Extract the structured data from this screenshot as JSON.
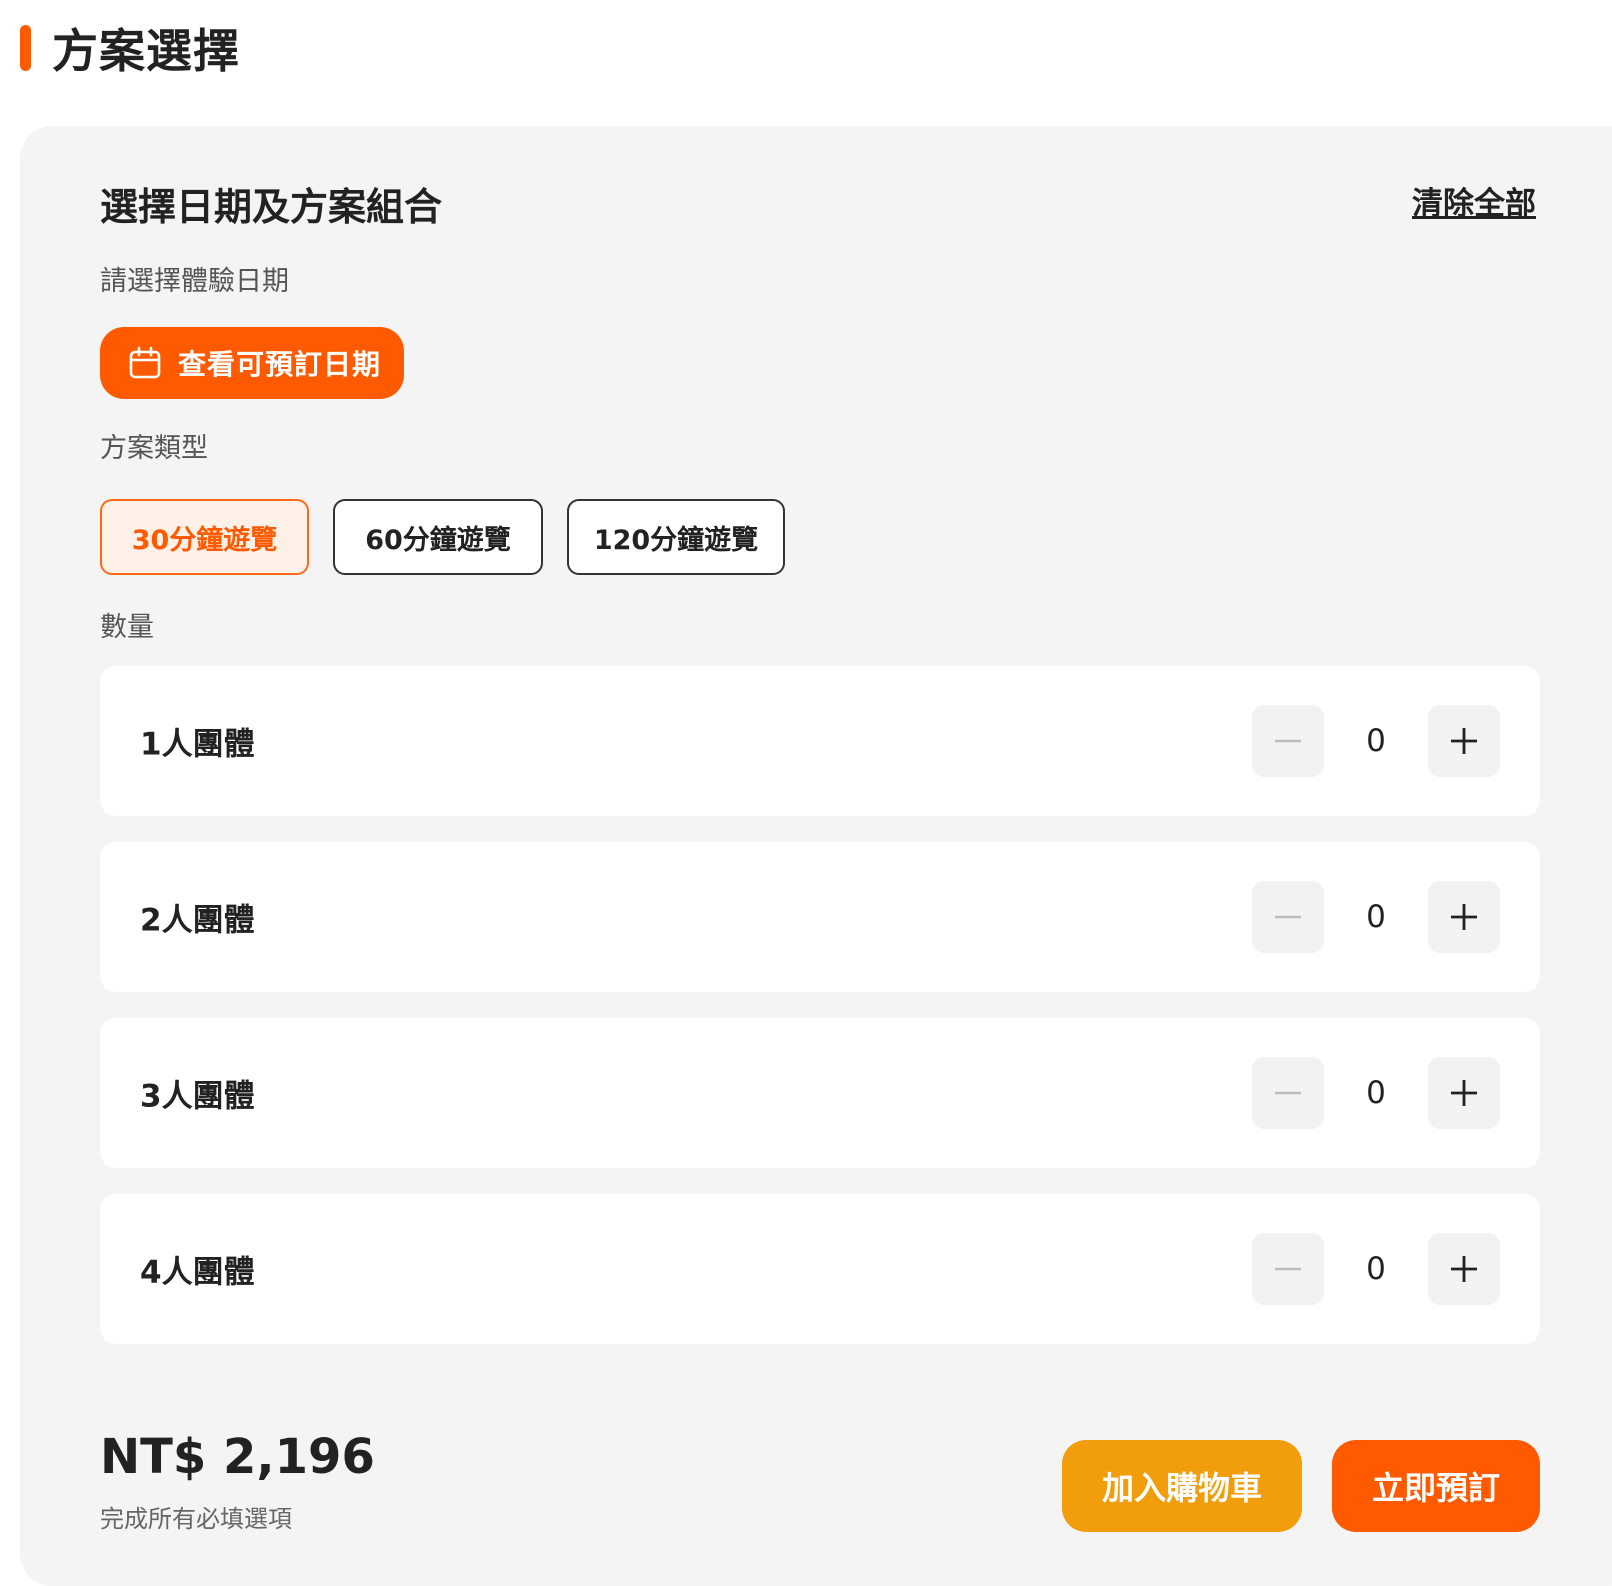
{
  "section": {
    "title": "方案選擇"
  },
  "panel": {
    "title": "選擇日期及方案組合",
    "clear_all": "清除全部"
  },
  "date": {
    "label": "請選擇體驗日期",
    "button_label": "查看可預訂日期",
    "icon": "calendar-icon"
  },
  "plan_type": {
    "label": "方案類型",
    "options": [
      {
        "label": "30分鐘遊覽",
        "selected": true
      },
      {
        "label": "60分鐘遊覽",
        "selected": false
      },
      {
        "label": "120分鐘遊覽",
        "selected": false
      }
    ]
  },
  "quantity": {
    "label": "數量",
    "rows": [
      {
        "label": "1人團體",
        "value": "0"
      },
      {
        "label": "2人團體",
        "value": "0"
      },
      {
        "label": "3人團體",
        "value": "0"
      },
      {
        "label": "4人團體",
        "value": "0"
      }
    ]
  },
  "footer": {
    "price": "NT$ 2,196",
    "note": "完成所有必填選項",
    "add_to_cart": "加入購物車",
    "book_now": "立即預訂"
  },
  "colors": {
    "accent": "#ff5a00",
    "cart": "#f29d0c",
    "panel_bg": "#f4f4f4"
  }
}
